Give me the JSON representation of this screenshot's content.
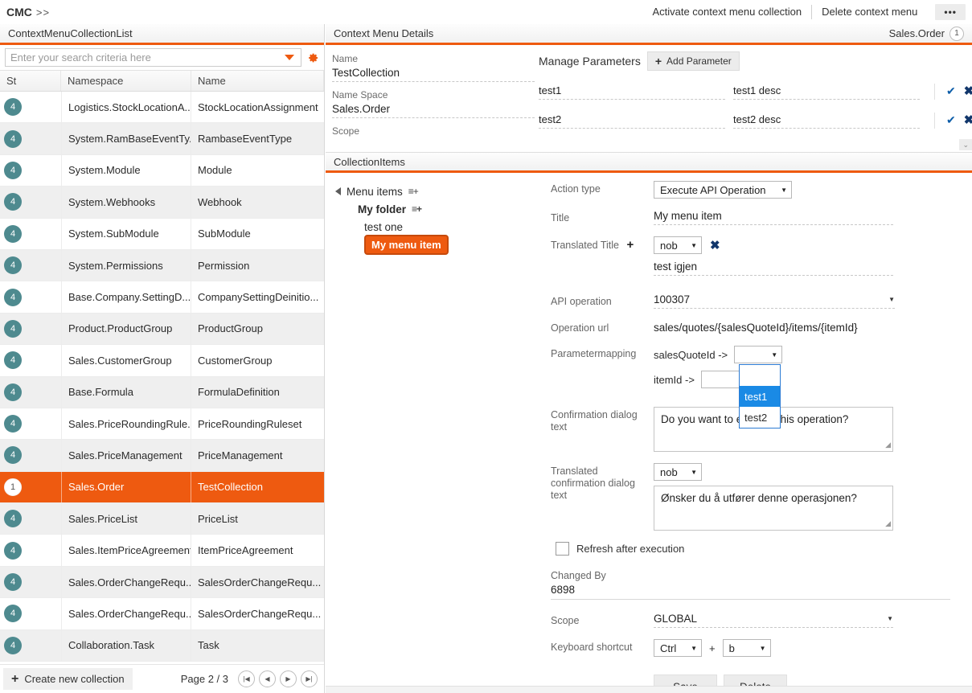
{
  "topbar": {
    "breadcrumb": "CMC",
    "breadcrumb_sep": ">>",
    "activate_label": "Activate context menu collection",
    "delete_label": "Delete context menu",
    "more_label": "•••"
  },
  "left_panel": {
    "title": "ContextMenuCollectionList",
    "search_placeholder": "Enter your search criteria here",
    "search_value": "",
    "columns": [
      "St",
      "Namespace",
      "Name"
    ],
    "rows": [
      {
        "st": "4",
        "namespace": "Logistics.StockLocationA...",
        "name": "StockLocationAssignment",
        "selected": false
      },
      {
        "st": "4",
        "namespace": "System.RamBaseEventTy...",
        "name": "RambaseEventType",
        "selected": false
      },
      {
        "st": "4",
        "namespace": "System.Module",
        "name": "Module",
        "selected": false
      },
      {
        "st": "4",
        "namespace": "System.Webhooks",
        "name": "Webhook",
        "selected": false
      },
      {
        "st": "4",
        "namespace": "System.SubModule",
        "name": "SubModule",
        "selected": false
      },
      {
        "st": "4",
        "namespace": "System.Permissions",
        "name": "Permission",
        "selected": false
      },
      {
        "st": "4",
        "namespace": "Base.Company.SettingD...",
        "name": "CompanySettingDeinitio...",
        "selected": false
      },
      {
        "st": "4",
        "namespace": "Product.ProductGroup",
        "name": "ProductGroup",
        "selected": false
      },
      {
        "st": "4",
        "namespace": "Sales.CustomerGroup",
        "name": "CustomerGroup",
        "selected": false
      },
      {
        "st": "4",
        "namespace": "Base.Formula",
        "name": "FormulaDefinition",
        "selected": false
      },
      {
        "st": "4",
        "namespace": "Sales.PriceRoundingRule...",
        "name": "PriceRoundingRuleset",
        "selected": false
      },
      {
        "st": "4",
        "namespace": "Sales.PriceManagement",
        "name": "PriceManagement",
        "selected": false
      },
      {
        "st": "1",
        "namespace": "Sales.Order",
        "name": "TestCollection",
        "selected": true
      },
      {
        "st": "4",
        "namespace": "Sales.PriceList",
        "name": "PriceList",
        "selected": false
      },
      {
        "st": "4",
        "namespace": "Sales.ItemPriceAgreement",
        "name": "ItemPriceAgreement",
        "selected": false
      },
      {
        "st": "4",
        "namespace": "Sales.OrderChangeRequ...",
        "name": "SalesOrderChangeRequ...",
        "selected": false
      },
      {
        "st": "4",
        "namespace": "Sales.OrderChangeRequ...",
        "name": "SalesOrderChangeRequ...",
        "selected": false
      },
      {
        "st": "4",
        "namespace": "Collaboration.Task",
        "name": "Task",
        "selected": false
      }
    ],
    "create_label": "Create new collection",
    "page_label": "Page 2 / 3",
    "pager": [
      "|◀",
      "◀",
      "▶",
      "▶|"
    ]
  },
  "details": {
    "title": "Context Menu Details",
    "badge_text": "Sales.Order",
    "badge_count": "1",
    "name_label": "Name",
    "name_value": "TestCollection",
    "namespace_label": "Name Space",
    "namespace_value": "Sales.Order",
    "scope_label": "Scope",
    "manage_params_label": "Manage Parameters",
    "add_param_label": "Add Parameter",
    "parameters": [
      {
        "name": "test1",
        "desc": "test1 desc"
      },
      {
        "name": "test2",
        "desc": "test2 desc"
      }
    ]
  },
  "collection_items": {
    "title": "CollectionItems",
    "tree": [
      {
        "label": "Menu items",
        "level": 0,
        "has_arrow": true,
        "has_menu_icon": true,
        "selected": false
      },
      {
        "label": "My folder",
        "level": 1,
        "has_arrow": false,
        "has_menu_icon": true,
        "selected": false
      },
      {
        "label": "test one",
        "level": 2,
        "has_arrow": false,
        "has_menu_icon": false,
        "selected": false
      },
      {
        "label": "My menu item",
        "level": 3,
        "has_arrow": false,
        "has_menu_icon": false,
        "selected": true
      }
    ],
    "form": {
      "action_type_label": "Action type",
      "action_type_value": "Execute API Operation",
      "title_label": "Title",
      "title_value": "My menu item",
      "translated_title_label": "Translated Title",
      "translated_title_lang": "nob",
      "translated_title_value": "test igjen",
      "api_operation_label": "API operation",
      "api_operation_value": "100307",
      "operation_url_label": "Operation url",
      "operation_url_value": "sales/quotes/{salesQuoteId}/items/{itemId}",
      "parametermapping_label": "Parametermapping",
      "param_map_1_key": "salesQuoteId ->",
      "param_map_1_value": "",
      "param_map_2_key": "itemId ->",
      "param_map_2_value": "",
      "dropdown_options": [
        "",
        "test1",
        "test2"
      ],
      "dropdown_highlighted": "test1",
      "confirm_dialog_label": "Confirmation dialog text",
      "confirm_dialog_value": "Do you want to execute this operation?",
      "translated_confirm_label": "Translated confirmation dialog text",
      "translated_confirm_lang": "nob",
      "translated_confirm_value": "Ønsker du å utfører denne operasjonen?",
      "refresh_label": "Refresh after execution",
      "refresh_checked": false,
      "changed_by_label": "Changed By",
      "changed_by_value": "6898",
      "scope_label": "Scope",
      "scope_value": "GLOBAL",
      "keyboard_label": "Keyboard shortcut",
      "keyboard_modifier": "Ctrl",
      "keyboard_plus": "+",
      "keyboard_key": "b",
      "save_label": "Save",
      "delete_label": "Delete"
    }
  },
  "colors": {
    "accent": "#ee5a10",
    "badge_teal": "#4e8a8f",
    "dropdown_highlight": "#1a8ae5"
  }
}
